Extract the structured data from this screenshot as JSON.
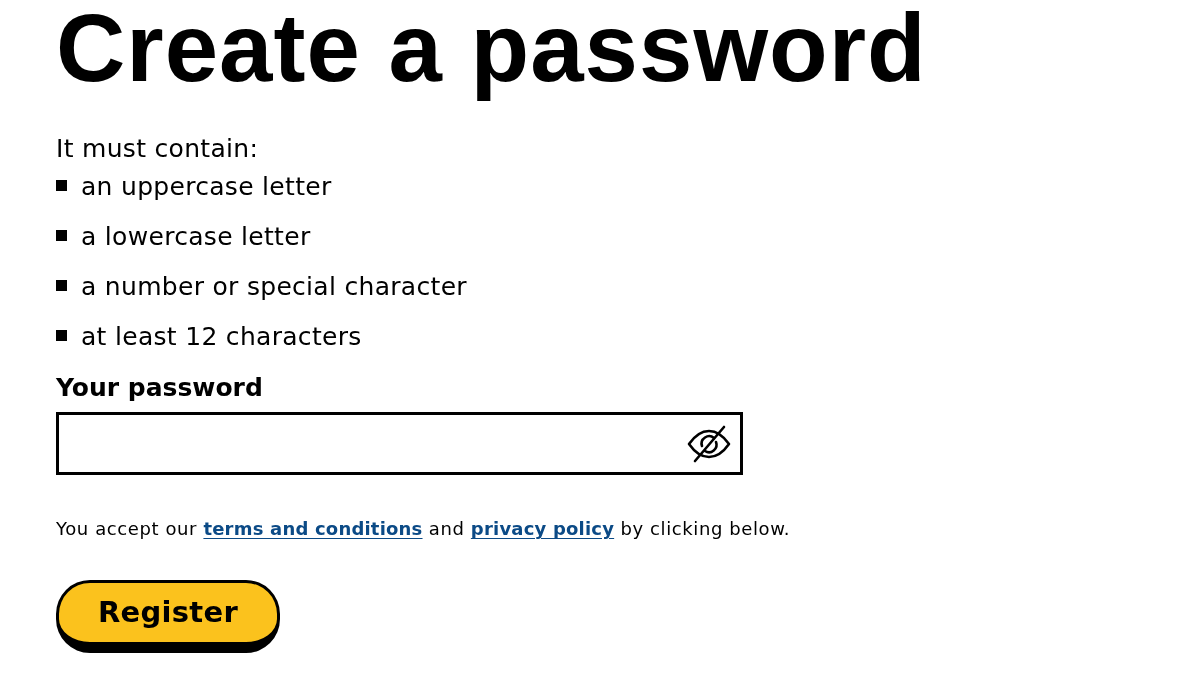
{
  "heading": "Create a password",
  "requirements": {
    "intro": "It must contain:",
    "items": [
      "an uppercase letter",
      "a lowercase letter",
      "a number or special character",
      "at least 12 characters"
    ]
  },
  "password_field": {
    "label": "Your password",
    "password_visible": false
  },
  "consent": [
    {
      "kind": "text",
      "text": "You accept our"
    },
    {
      "kind": "link",
      "text": "terms and conditions"
    },
    {
      "kind": "text",
      "text": "and"
    },
    {
      "kind": "link",
      "text": "privacy policy"
    },
    {
      "kind": "text",
      "text": "by clicking below."
    }
  ],
  "submit_button": {
    "label": "Register"
  }
}
